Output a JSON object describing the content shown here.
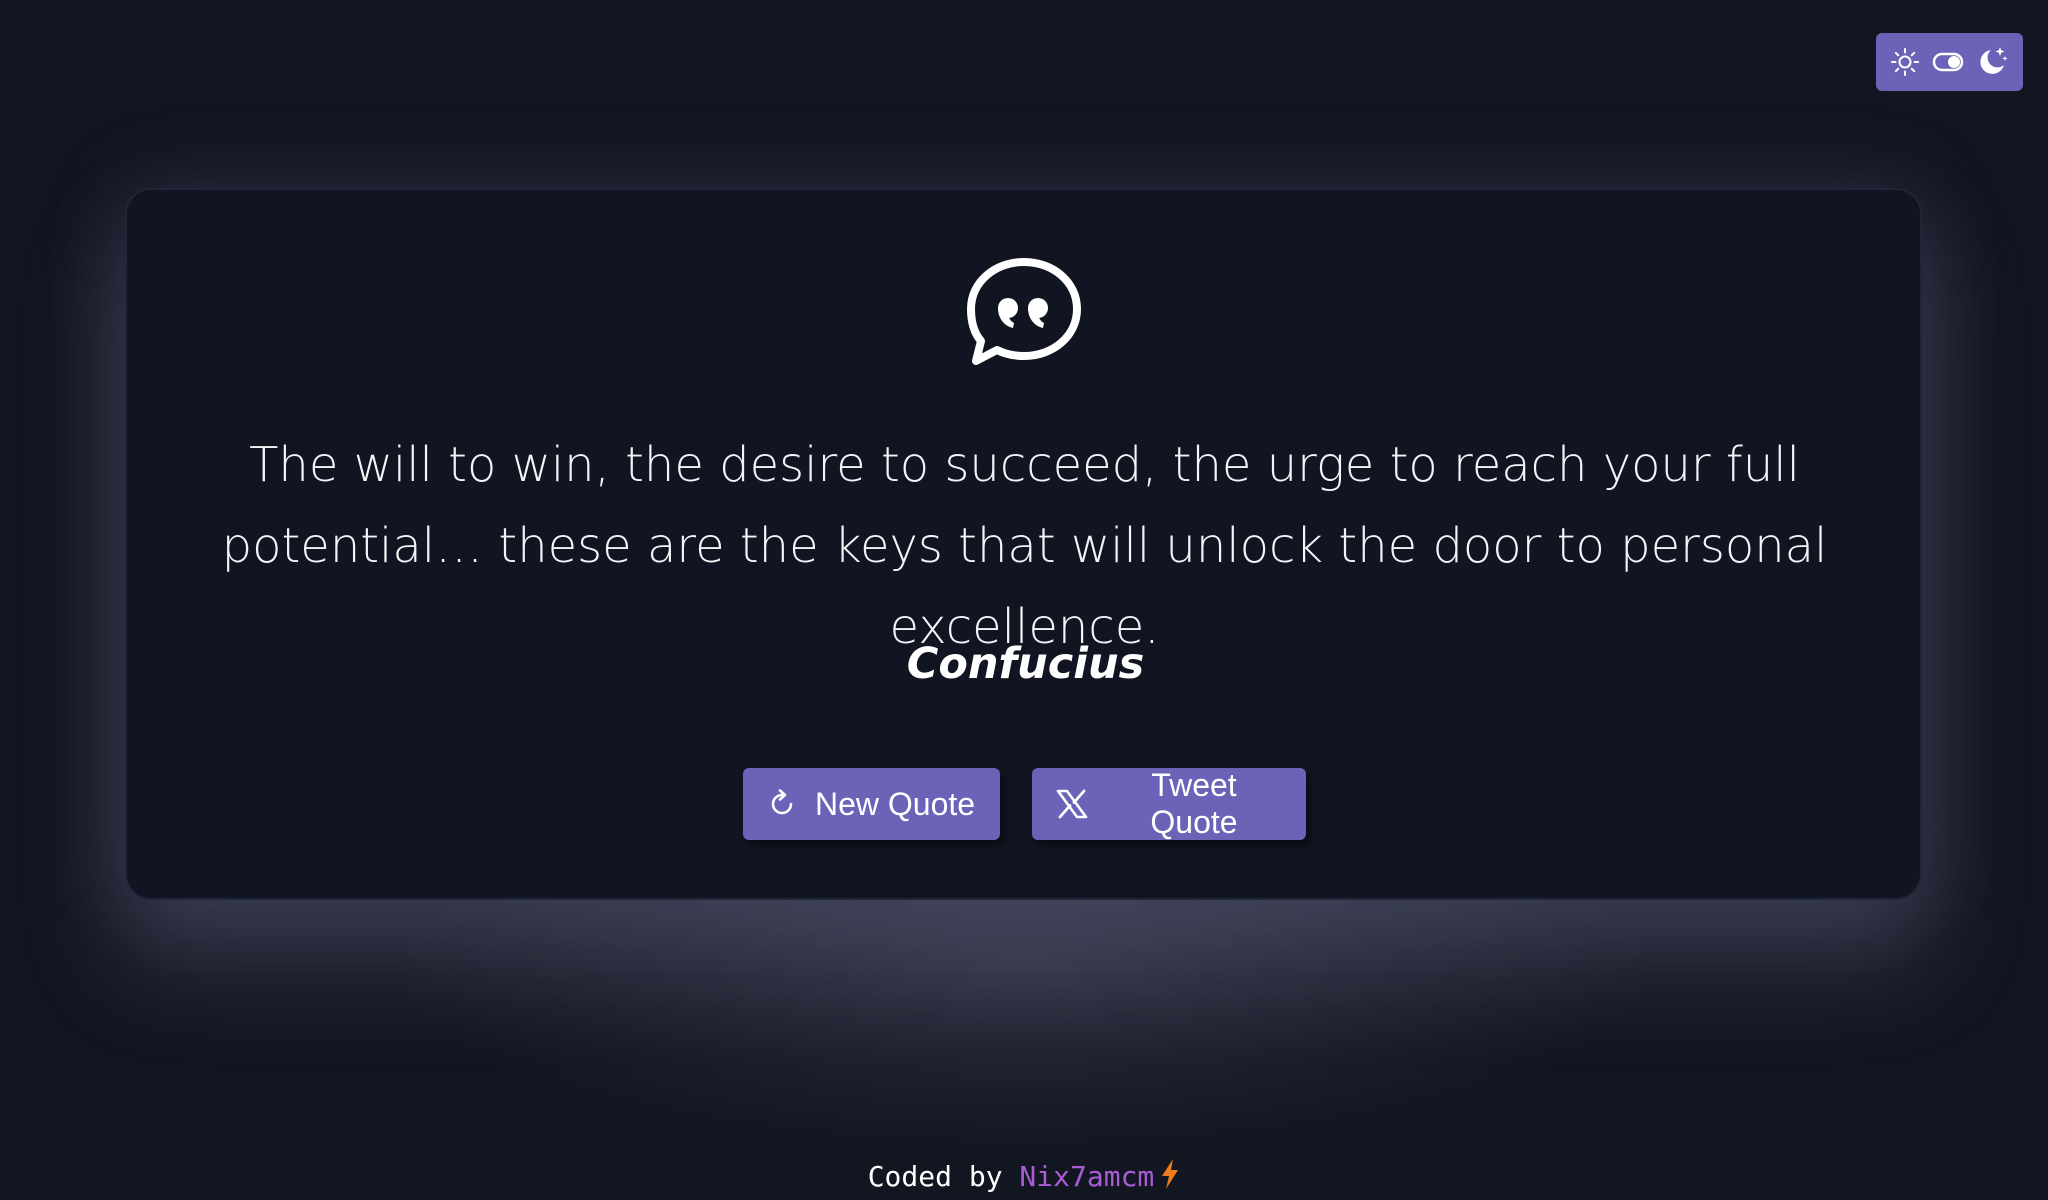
{
  "theme_toggle": {
    "light_icon": "sun-icon",
    "switch_icon": "toggle-switch-icon",
    "dark_icon": "moon-stars-icon",
    "mode": "dark"
  },
  "card": {
    "icon": "quote-bubble-icon",
    "quote": "The will to win, the desire to succeed, the urge to reach your full potential… these are the keys that will unlock the door to personal excellence.",
    "author": "Confucius"
  },
  "buttons": {
    "new_quote": {
      "label": "New Quote",
      "icon": "refresh-icon"
    },
    "tweet_quote": {
      "label": "Tweet Quote",
      "icon": "x-logo-icon"
    }
  },
  "footer": {
    "prefix": "Coded by ",
    "author": "Nix7amcm",
    "icon": "lightning-bolt-icon"
  },
  "colors": {
    "background": "#121620",
    "card": "#111522",
    "accent": "#6b63b8",
    "author_link": "#a95cd6",
    "bolt": "#f07b1e"
  }
}
